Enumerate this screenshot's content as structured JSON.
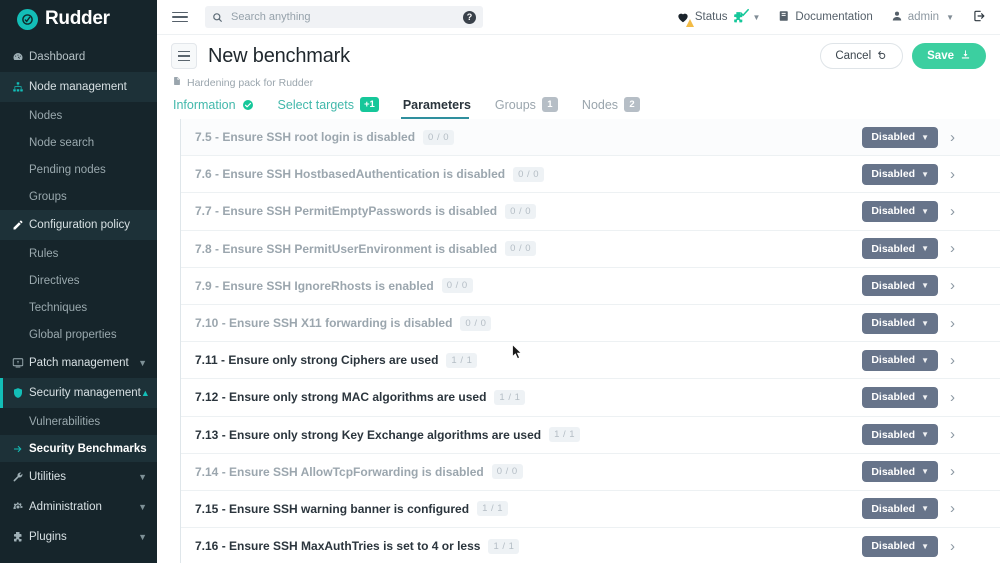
{
  "brand": {
    "name": "Rudder",
    "logo_icon": "rudder-logo-icon",
    "accent": "#13beb7"
  },
  "sidebar": {
    "items": [
      {
        "label": "Dashboard",
        "icon": "dashboard-icon",
        "type": "link"
      },
      {
        "label": "Node management",
        "icon": "sitemap-icon",
        "type": "section-open"
      },
      {
        "label": "Nodes",
        "type": "sub"
      },
      {
        "label": "Node search",
        "type": "sub"
      },
      {
        "label": "Pending nodes",
        "type": "sub"
      },
      {
        "label": "Groups",
        "type": "sub"
      },
      {
        "label": "Configuration policy",
        "icon": "pencil-icon",
        "type": "section-open"
      },
      {
        "label": "Rules",
        "type": "sub"
      },
      {
        "label": "Directives",
        "type": "sub"
      },
      {
        "label": "Techniques",
        "type": "sub"
      },
      {
        "label": "Global properties",
        "type": "sub"
      },
      {
        "label": "Patch management",
        "icon": "patch-icon",
        "type": "section",
        "caret": "chevron-down-icon"
      },
      {
        "label": "Security management",
        "icon": "shield-icon",
        "type": "section-open-accent",
        "caret": "chevron-up-icon"
      },
      {
        "label": "Vulnerabilities",
        "type": "sub"
      },
      {
        "label": "Security Benchmarks",
        "type": "sub-active",
        "icon": "arrow-right-icon"
      },
      {
        "label": "Utilities",
        "icon": "wrench-icon",
        "type": "section",
        "caret": "chevron-down-icon"
      },
      {
        "label": "Administration",
        "icon": "gear-icon",
        "type": "section",
        "caret": "chevron-down-icon"
      },
      {
        "label": "Plugins",
        "icon": "plugin-icon",
        "type": "section",
        "caret": "chevron-down-icon"
      }
    ]
  },
  "topbar": {
    "menu_icon": "hamburger-icon",
    "search": {
      "icon": "search-icon",
      "placeholder": "Search anything",
      "value": "",
      "help_icon": "question-circle-icon"
    },
    "status": {
      "label": "Status",
      "heart_icon": "heart-icon",
      "warning_icon": "warning-triangle-icon",
      "plugin_icon": "plugin-status-icon",
      "check_icon": "check-icon",
      "caret": "caret-down-icon"
    },
    "documentation": {
      "label": "Documentation",
      "icon": "book-icon"
    },
    "user": {
      "label": "admin",
      "icon": "user-icon",
      "caret": "caret-down-icon"
    },
    "logout": {
      "icon": "logout-icon"
    }
  },
  "page": {
    "menu_button_icon": "list-menu-icon",
    "title": "New benchmark",
    "breadcrumb": {
      "icon": "file-icon",
      "label": "Hardening pack for Rudder"
    },
    "cancel_label": "Cancel",
    "cancel_icon": "undo-icon",
    "save_label": "Save",
    "save_icon": "download-icon",
    "tabs": [
      {
        "label": "Information",
        "state": "done",
        "badge": null,
        "badge_kind": null,
        "icon": "check-circle-icon"
      },
      {
        "label": "Select targets",
        "state": "link",
        "badge": "+1",
        "badge_kind": "teal"
      },
      {
        "label": "Parameters",
        "state": "active",
        "badge": null
      },
      {
        "label": "Groups",
        "state": "muted",
        "badge": "1",
        "badge_kind": "grey"
      },
      {
        "label": "Nodes",
        "state": "muted",
        "badge": "2",
        "badge_kind": "grey"
      }
    ]
  },
  "list": {
    "state_caret_icon": "caret-down-icon",
    "expand_icon": "chevron-right-icon",
    "rows": [
      {
        "title": "7.5 - Ensure SSH root login is disabled",
        "count": "0 / 0",
        "state": "Disabled",
        "active": false
      },
      {
        "title": "7.6 - Ensure SSH HostbasedAuthentication is disabled",
        "count": "0 / 0",
        "state": "Disabled",
        "active": false
      },
      {
        "title": "7.7 - Ensure SSH PermitEmptyPasswords is disabled",
        "count": "0 / 0",
        "state": "Disabled",
        "active": false
      },
      {
        "title": "7.8 - Ensure SSH PermitUserEnvironment is disabled",
        "count": "0 / 0",
        "state": "Disabled",
        "active": false
      },
      {
        "title": "7.9 - Ensure SSH IgnoreRhosts is enabled",
        "count": "0 / 0",
        "state": "Disabled",
        "active": false
      },
      {
        "title": "7.10 - Ensure SSH X11 forwarding is disabled",
        "count": "0 / 0",
        "state": "Disabled",
        "active": false
      },
      {
        "title": "7.11 - Ensure only strong Ciphers are used",
        "count": "1 / 1",
        "state": "Disabled",
        "active": true
      },
      {
        "title": "7.12 - Ensure only strong MAC algorithms are used",
        "count": "1 / 1",
        "state": "Disabled",
        "active": true
      },
      {
        "title": "7.13 - Ensure only strong Key Exchange algorithms are used",
        "count": "1 / 1",
        "state": "Disabled",
        "active": true
      },
      {
        "title": "7.14 - Ensure SSH AllowTcpForwarding is disabled",
        "count": "0 / 0",
        "state": "Disabled",
        "active": false
      },
      {
        "title": "7.15 - Ensure SSH warning banner is configured",
        "count": "1 / 1",
        "state": "Disabled",
        "active": true
      },
      {
        "title": "7.16 - Ensure SSH MaxAuthTries is set to 4 or less",
        "count": "1 / 1",
        "state": "Disabled",
        "active": true
      }
    ]
  },
  "colors": {
    "sidebar_bg": "#16252b",
    "accent_teal": "#13beb7",
    "save_green": "#3ccfa0",
    "badge_slate": "#67748a",
    "tab_active_underline": "#2f8f9e"
  }
}
